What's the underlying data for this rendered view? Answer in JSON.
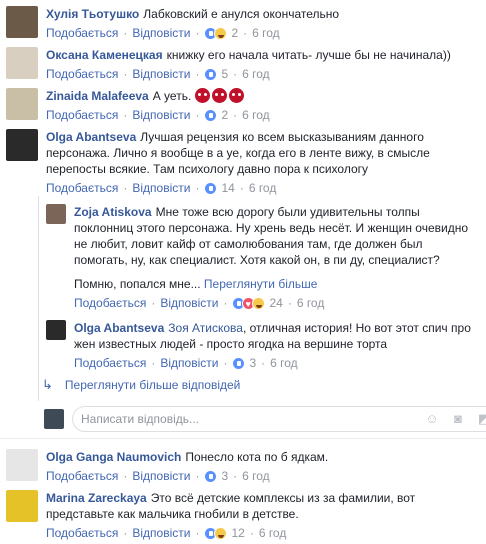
{
  "comments": [
    {
      "author": "Хулія Тьотушко",
      "text": "Лабковский е  анулся окончательно",
      "like": "Подобається",
      "reply": "Відповісти",
      "count": "2",
      "time": "6 год"
    },
    {
      "author": "Оксана Каменецкая",
      "text": "книжку его начала читать- лучше бы не начинала))",
      "like": "Подобається",
      "reply": "Відповісти",
      "count": "5",
      "time": "6 год"
    },
    {
      "author": "Zinaida Malafeeva",
      "text": "А  уеть.",
      "like": "Подобається",
      "reply": "Відповісти",
      "count": "2",
      "time": "6 год"
    },
    {
      "author": "Olga Abantseva",
      "text": "Лучшая рецензия ко всем высказываниям данного персонажа. Лично я вообще в а  уе, когда его в ленте вижу, в смысле перепосты всякие. Там психологу давно пора к психологу",
      "like": "Подобається",
      "reply": "Відповісти",
      "count": "14",
      "time": "6 год"
    },
    {
      "author": "Olga Ganga Naumovich",
      "text": "Понесло кота по б  ядкам.",
      "like": "Подобається",
      "reply": "Відповісти",
      "count": "3",
      "time": "6 год"
    },
    {
      "author": "Marina Zareckaya",
      "text": "Это всё детские комплексы из за фамилии, вот представьте как мальчика гнобили в детстве.",
      "like": "Подобається",
      "reply": "Відповісти",
      "count": "12",
      "time": "6 год"
    }
  ],
  "replies": [
    {
      "author": "Zoja Atiskova",
      "text": "Мне тоже всю дорогу были удивительны толпы поклонниц этого персонажа. Ну хрень ведь несёт. И женщин очевидно не любит, ловит кайф от самолюбования там, где должен был помогать, ну, как специалист. Хотя какой он, в пи  ду, специалист?",
      "text2": "Помню, попался мне...",
      "see_more": "Переглянути більше",
      "like": "Подобається",
      "reply": "Відповісти",
      "count": "24",
      "time": "6 год"
    },
    {
      "author": "Olga Abantseva",
      "mention": "Зоя Атискова",
      "text": ", отличная история! Но вот этот спич про жен известных людей - просто ягодка на вершине торта",
      "like": "Подобається",
      "reply": "Відповісти",
      "count": "3",
      "time": "6 год"
    }
  ],
  "more_replies": "Переглянути більше відповідей",
  "reply_placeholder": "Написати відповідь...",
  "icons": [
    "emoji-icon",
    "camera-icon",
    "sticker-icon",
    "reply-arrow-icon"
  ],
  "colors": {
    "link": "#365899",
    "action": "#4267b2",
    "muted": "#90949c",
    "like": "#5890ff",
    "haha": "#f7c94a",
    "love": "#f25268"
  }
}
